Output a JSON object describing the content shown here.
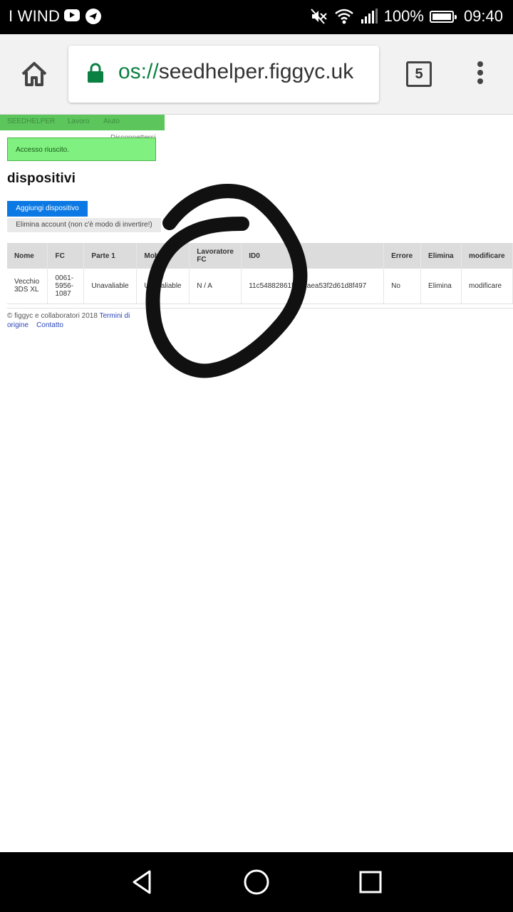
{
  "status_bar": {
    "carrier": "I WIND",
    "battery": "100%",
    "time": "09:40"
  },
  "browser": {
    "url_scheme": "os://",
    "url_host": "seedhelper.figgyc.uk",
    "tab_count": "5"
  },
  "site": {
    "nav": [
      "SEEDHELPER",
      "Lavoro",
      "Aiuto"
    ],
    "logout": "Disconnettersi",
    "alert": "Accesso riuscito.",
    "title": "dispositivi",
    "add_button": "Aggiungi dispositivo",
    "delete_account_button": "Elimina account (non c'è modo di invertire!)"
  },
  "table": {
    "headers": [
      "Nome",
      "FC",
      "Parte 1",
      "Mobile",
      "Lavoratore FC",
      "ID0",
      "Errore",
      "Elimina",
      "modificare"
    ],
    "rows": [
      [
        "Vecchio 3DS XL",
        "0061-5956-1087",
        "Unavaliable",
        "Unavaliable",
        "N / A",
        "11c54882861b40caea53f2d61d8f497",
        "No",
        "Elimina",
        "modificare"
      ]
    ]
  },
  "footer": {
    "copyright": "© figgyc e collaboratori 2018",
    "terms": "Termini di origine",
    "contact": "Contatto"
  },
  "colors": {
    "nav_green": "#5cc55c",
    "alert_green": "#80f080",
    "primary_blue": "#0b78e3",
    "secure_green": "#0b8043"
  }
}
